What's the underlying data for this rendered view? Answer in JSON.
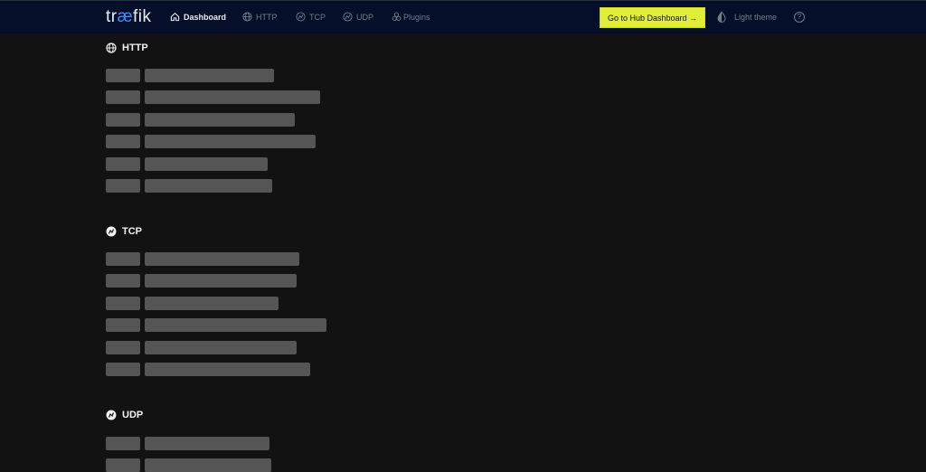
{
  "nav": {
    "logo": {
      "pre": "tr",
      "ae": "æ",
      "post": "fik"
    },
    "items": [
      {
        "label": "Dashboard",
        "icon": "home-icon",
        "active": true
      },
      {
        "label": "HTTP",
        "icon": "globe-icon",
        "active": false
      },
      {
        "label": "TCP",
        "icon": "tcp-icon",
        "active": false
      },
      {
        "label": "UDP",
        "icon": "udp-icon",
        "active": false
      },
      {
        "label": "Plugins",
        "icon": "plugins-icon",
        "active": false
      }
    ],
    "hub_button": "Go to Hub Dashboard →",
    "theme_toggle": "Light theme",
    "help": "?"
  },
  "sections": [
    {
      "title": "HTTP",
      "icon": "globe-icon"
    },
    {
      "title": "TCP",
      "icon": "tcp-icon"
    },
    {
      "title": "UDP",
      "icon": "udp-icon"
    }
  ],
  "colors": {
    "nav_bg": "#060f29",
    "page_bg": "#121212",
    "accent": "#e0ee3a",
    "skeleton": "#555555"
  }
}
